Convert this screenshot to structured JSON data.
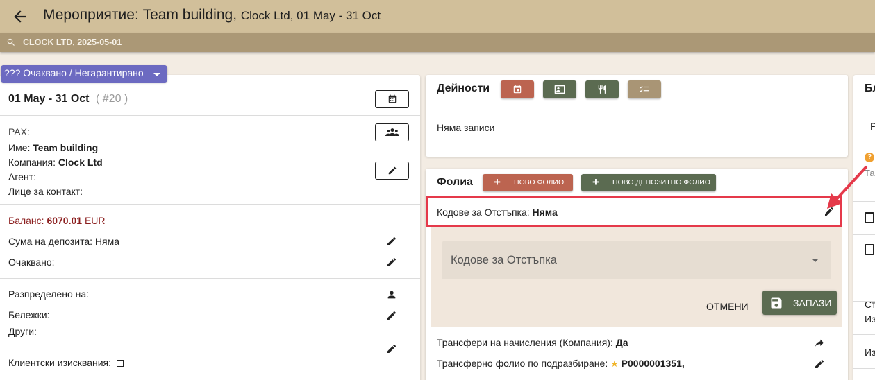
{
  "header": {
    "title": "Мероприятие: Team building,",
    "subtitle": "Clock Ltd, 01 May - 31 Oct"
  },
  "search_bar": {
    "text": "CLOCK LTD, 2025-05-01"
  },
  "status": {
    "label": "??? Очаквано / Негарантирано"
  },
  "left": {
    "dates": "01 May - 31 Oct",
    "number": "( #20 )",
    "pax_label": "PAX:",
    "name_label": "Име:",
    "name_value": "Team building",
    "company_label": "Компания:",
    "company_value": "Clock Ltd",
    "agent_label": "Агент:",
    "contact_label": "Лице за контакт:",
    "balance_label": "Баланс:",
    "balance_value": "6070.01",
    "balance_currency": "EUR",
    "deposit_label": "Сума на депозита: Няма",
    "expected_label": "Очаквано:",
    "assigned_label": "Разпределено на:",
    "notes_label": "Бележки:",
    "other_label": "Други:",
    "client_req_label": "Клиентски изисквания:"
  },
  "activities": {
    "title": "Дейности",
    "empty": "Няма записи",
    "buttons": [
      {
        "icon": "calendar-icon",
        "color": "#bc6450"
      },
      {
        "icon": "contact-card-icon",
        "color": "#5b6b51"
      },
      {
        "icon": "restaurant-icon",
        "color": "#5b6b51"
      },
      {
        "icon": "checklist-icon",
        "color": "#a99575"
      }
    ]
  },
  "folio": {
    "title": "Фолиа",
    "new_folio": "НОВО ФОЛИО",
    "new_deposit_folio": "НОВО ДЕПОЗИТНО ФОЛИО",
    "discount_label": "Кодове за Отстъпка:",
    "discount_value": "Няма",
    "select_placeholder": "Кодове за Отстъпка",
    "cancel": "ОТМЕНИ",
    "save": "ЗАПАЗИ",
    "transfers_label": "Трансфери на начисления (Компания):",
    "transfers_value": "Да",
    "default_folio_label": "Трансферно фолио по подразбиране:",
    "default_folio_value": "P0000001351,"
  },
  "right": {
    "title_frag": "Бл",
    "f1": "Р",
    "f2": "Та",
    "f3": "Ст",
    "f4": "Из",
    "f5": "Из"
  },
  "colors": {
    "header": "#d1bf9a",
    "subbar": "#ab9876",
    "status_chip": "#6c6ac1",
    "accent_red": "#bc6450",
    "accent_green": "#5b6b51",
    "balance": "#8b1e1e",
    "highlight": "#e5394a"
  }
}
